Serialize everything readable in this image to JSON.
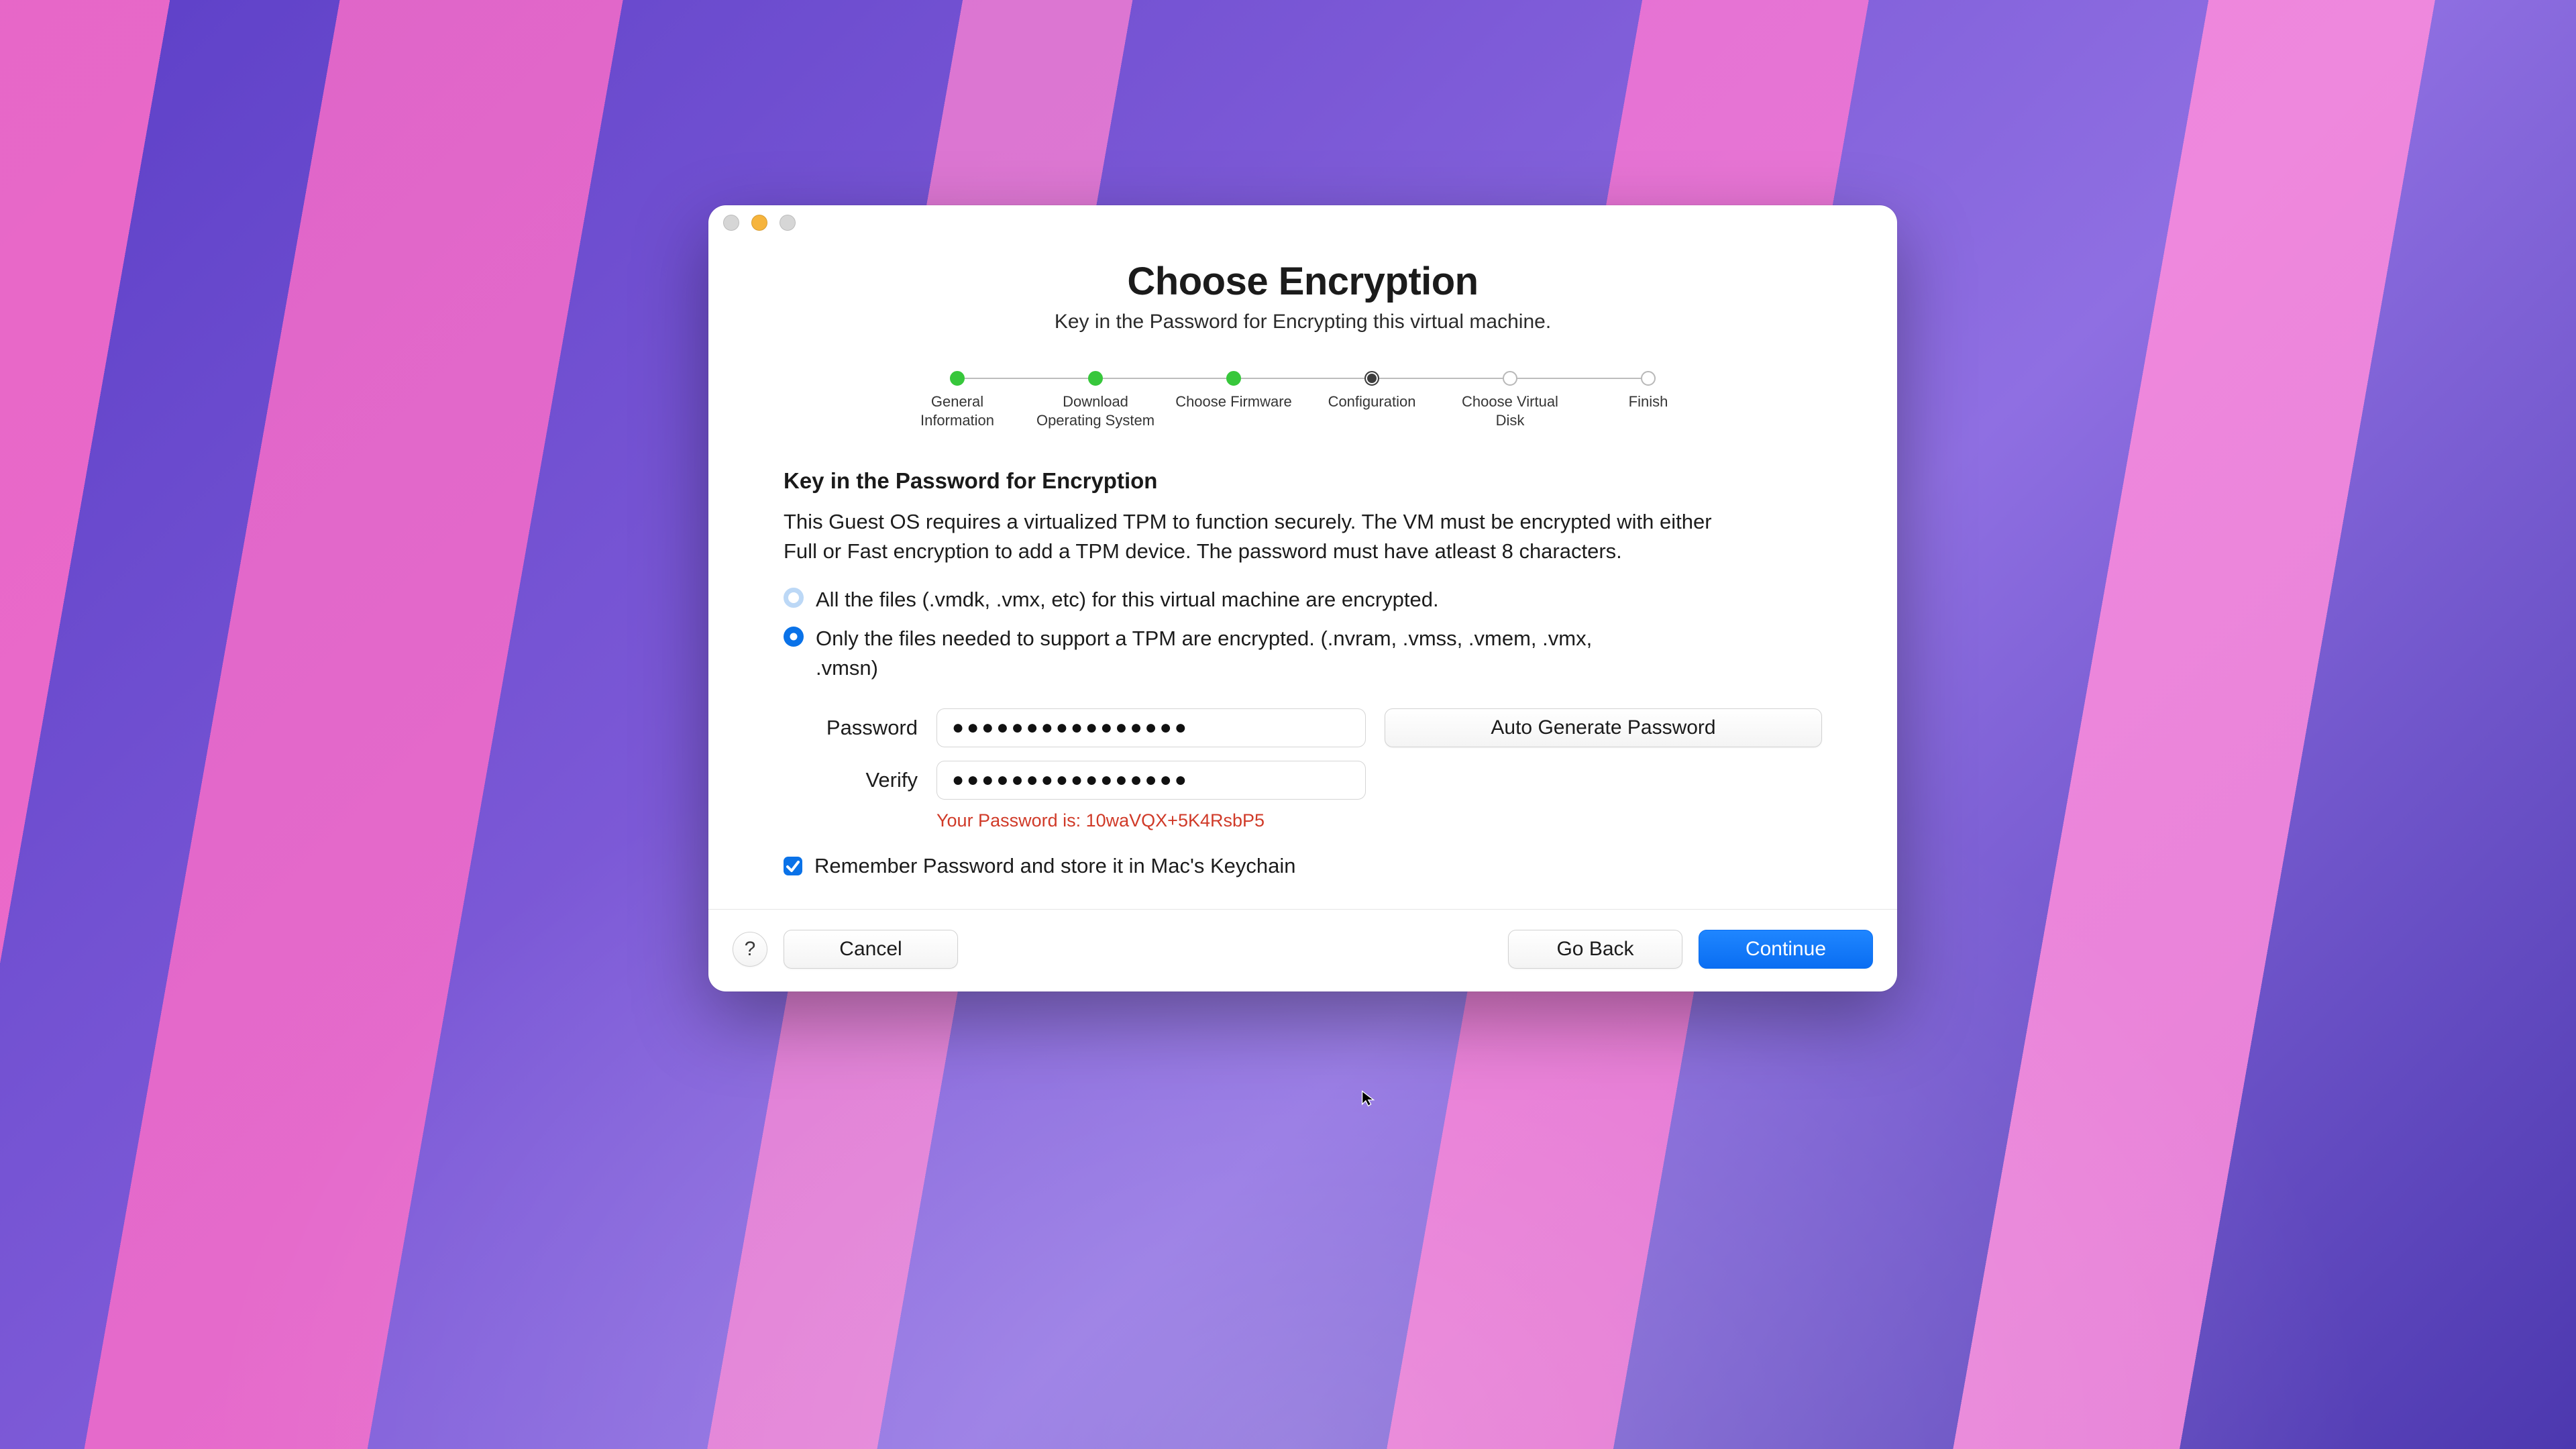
{
  "window": {
    "title": "Choose Encryption",
    "subtitle": "Key in the Password for Encrypting this virtual machine."
  },
  "stepper": [
    {
      "label": "General Information",
      "state": "done"
    },
    {
      "label": "Download Operating System",
      "state": "done"
    },
    {
      "label": "Choose Firmware",
      "state": "done"
    },
    {
      "label": "Configuration",
      "state": "current"
    },
    {
      "label": "Choose Virtual Disk",
      "state": "todo"
    },
    {
      "label": "Finish",
      "state": "todo"
    }
  ],
  "section": {
    "heading": "Key in the Password for Encryption",
    "body": "This Guest OS requires a virtualized TPM to function securely. The VM must be encrypted with either Full or Fast encryption to add a TPM device. The password must have atleast 8 characters."
  },
  "options": {
    "full": {
      "label": "All the files (.vmdk, .vmx, etc) for this virtual machine are encrypted.",
      "selected": false
    },
    "fast": {
      "label": "Only the files needed to support a TPM are encrypted. (.nvram, .vmss, .vmem, .vmx, .vmsn)",
      "selected": true
    }
  },
  "form": {
    "password_label": "Password",
    "password_value": "●●●●●●●●●●●●●●●●",
    "verify_label": "Verify",
    "verify_value": "●●●●●●●●●●●●●●●●",
    "autogen_label": "Auto Generate Password",
    "disclosure_prefix": "Your Password is: ",
    "disclosure_value": "10waVQX+5K4RsbP5"
  },
  "remember": {
    "checked": true,
    "label": "Remember Password and store it in Mac's Keychain"
  },
  "footer": {
    "help": "?",
    "cancel": "Cancel",
    "goback": "Go Back",
    "continue": "Continue"
  },
  "colors": {
    "accent": "#0a72e8",
    "step_done": "#37c73b",
    "warning_text": "#d03a28"
  }
}
